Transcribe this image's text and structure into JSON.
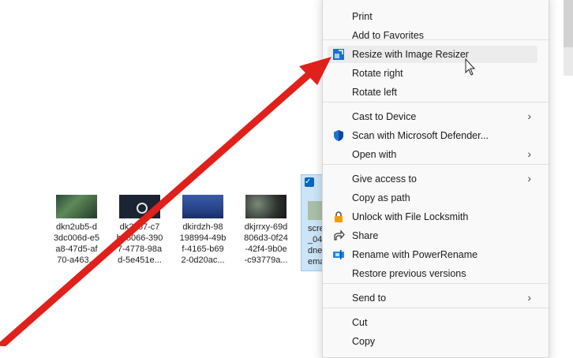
{
  "files": [
    {
      "name": "dkn2ub5-d\n3dc006d-e5\na8-47d5-af\n70-a463..."
    },
    {
      "name": "dk2xo7-c7\nbe5066-390\n7-4778-98a\nd-5e451e..."
    },
    {
      "name": "dkirdzh-98\n198994-49b\nf-4165-b69\n2-0d20ac..."
    },
    {
      "name": "dkjrrxy-69d\n806d3-0f24\n-42f4-9b0e\n-c93779a..."
    },
    {
      "name": "scre\n_04\ndne\nema"
    }
  ],
  "context_menu": {
    "items": [
      {
        "label": "Print",
        "icon": "",
        "submenu": false
      },
      {
        "label": "Add to Favorites",
        "icon": "",
        "submenu": false
      },
      {
        "label": "Resize with Image Resizer",
        "icon": "image-resizer-icon",
        "submenu": false
      },
      {
        "label": "Rotate right",
        "icon": "",
        "submenu": false
      },
      {
        "label": "Rotate left",
        "icon": "",
        "submenu": false
      },
      {
        "label": "Cast to Device",
        "icon": "",
        "submenu": true
      },
      {
        "label": "Scan with Microsoft Defender...",
        "icon": "defender-shield-icon",
        "submenu": false
      },
      {
        "label": "Open with",
        "icon": "",
        "submenu": true
      },
      {
        "label": "Give access to",
        "icon": "",
        "submenu": true
      },
      {
        "label": "Copy as path",
        "icon": "",
        "submenu": false
      },
      {
        "label": "Unlock with File Locksmith",
        "icon": "lock-icon",
        "submenu": false
      },
      {
        "label": "Share",
        "icon": "share-icon",
        "submenu": false
      },
      {
        "label": "Rename with PowerRename",
        "icon": "power-rename-icon",
        "submenu": false
      },
      {
        "label": "Restore previous versions",
        "icon": "",
        "submenu": false
      },
      {
        "label": "Send to",
        "icon": "",
        "submenu": true
      },
      {
        "label": "Cut",
        "icon": "",
        "submenu": false
      },
      {
        "label": "Copy",
        "icon": "",
        "submenu": false
      }
    ],
    "chevron": "›"
  },
  "colors": {
    "arrow": "#e0201b",
    "selection": "#cce4f7",
    "accent": "#0067c0"
  }
}
